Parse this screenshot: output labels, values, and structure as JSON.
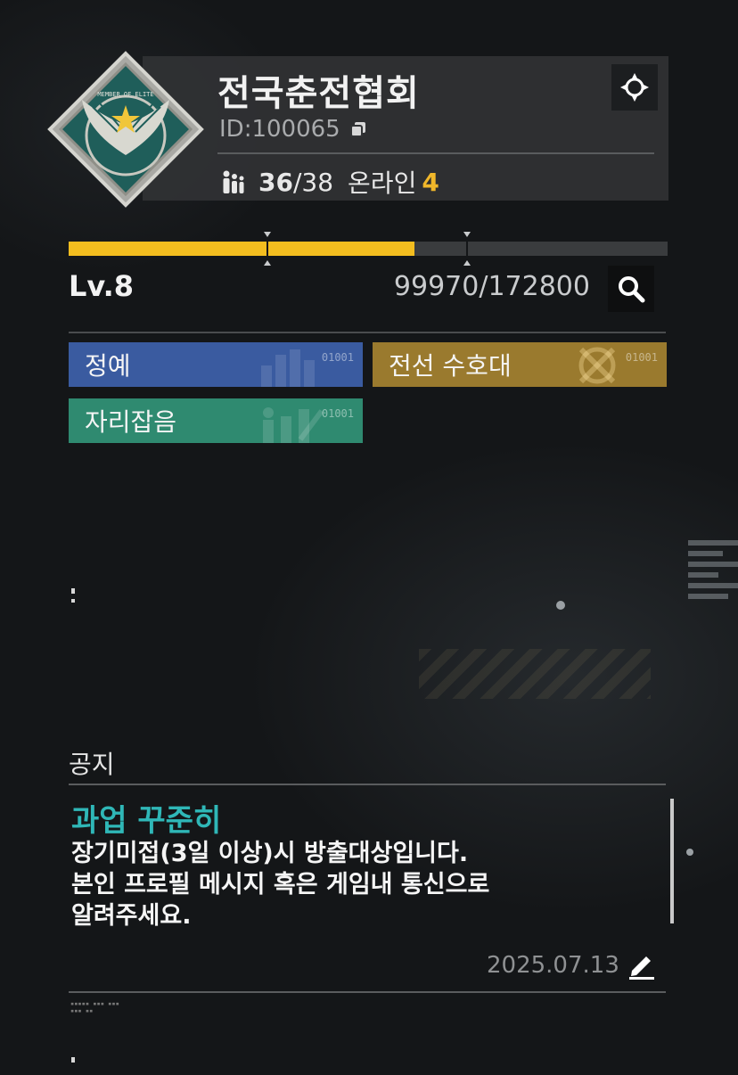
{
  "guild": {
    "name": "전국춘전협회",
    "id_label": "ID:",
    "id_value": "100065",
    "members_current": "36",
    "members_separator": "/",
    "members_max": "38",
    "online_label": "온라인",
    "online_count": "4",
    "emblem_text": "MEMBER OF ELITE"
  },
  "progress": {
    "level": "Lv.8",
    "xp_text": "99970/172800",
    "xp_fraction": 0.578
  },
  "tags": [
    {
      "label": "정예",
      "code": "01001",
      "color": "#3a5ba0"
    },
    {
      "label": "전선 수호대",
      "code": "01001",
      "color": "#9a7a2e"
    },
    {
      "label": "자리잡음",
      "code": "01001",
      "color": "#2f8a70"
    }
  ],
  "notice": {
    "section_title": "공지",
    "headline": "과업 꾸준히",
    "lines": [
      "장기미접(3일 이상)시 방출대상입니다.",
      "본인 프로필 메시지 혹은 게임내 통신으로",
      "알려주세요."
    ],
    "date": "2025.07.13"
  },
  "icons": {
    "target": "crosshair-icon",
    "copy": "copy-icon",
    "members": "people-icon",
    "search": "search-icon",
    "edit": "edit-icon"
  },
  "colors": {
    "accent_yellow": "#f3bd1f",
    "accent_cyan": "#2fb7b7",
    "background": "#141618"
  }
}
